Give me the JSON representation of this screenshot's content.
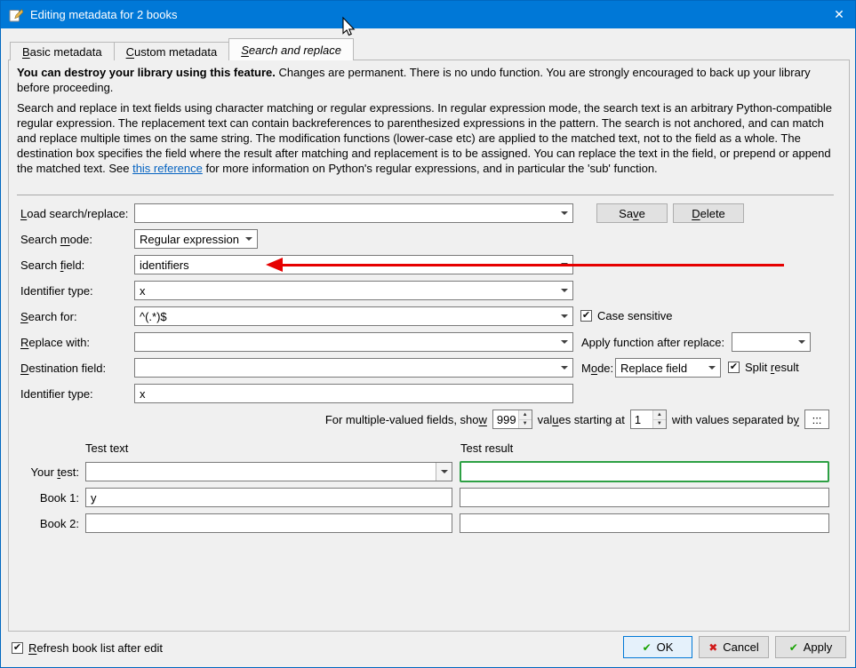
{
  "window": {
    "title": "Editing metadata for 2 books"
  },
  "icons": {
    "close": "✕",
    "check": "✔",
    "ok_icon": "✔",
    "cancel_icon": "✖",
    "apply_icon": "✔",
    "spin_up": "▲",
    "spin_down": "▼"
  },
  "tabs": [
    {
      "label": "&Basic metadata",
      "active": false
    },
    {
      "label": "&Custom metadata",
      "active": false
    },
    {
      "label": "&Search and replace",
      "active": true
    }
  ],
  "intro": {
    "warning_bold": "You can destroy your library using this feature.",
    "warning_rest": " Changes are permanent. There is no undo function. You are strongly encouraged to back up your library before proceeding.",
    "description": "Search and replace in text fields using character matching or regular expressions. In regular expression mode, the search text is an arbitrary Python-compatible regular expression. The replacement text can contain backreferences to parenthesized expressions in the pattern. The search is not anchored, and can match and replace multiple times on the same string. The modification functions (lower-case etc) are applied to the matched text, not to the field as a whole. The destination box specifies the field where the result after matching and replacement is to be assigned. You can replace the text in the field, or prepend or append the matched text. See ",
    "link_text": "this reference",
    "description_tail": " for more information on Python's regular expressions, and in particular the 'sub' function."
  },
  "form": {
    "load_label": "&Load search/replace:",
    "load_value": "",
    "save_button": "Sa&ve",
    "delete_button": "&Delete",
    "search_mode_label": "Search &mode:",
    "search_mode_value": "Regular expression",
    "search_field_label": "Search &field:",
    "search_field_value": "identifiers",
    "identifier_type_label": "Identifier type:",
    "identifier_type_value": "x",
    "search_for_label": "&Search for:",
    "search_for_value": "^(.*)$",
    "case_sensitive_label": "Case sensitive",
    "case_sensitive_checked": true,
    "replace_with_label": "&Replace with:",
    "replace_with_value": "",
    "apply_function_label": "Apply function after replace:",
    "apply_function_value": "",
    "destination_label": "&Destination field:",
    "destination_value": "",
    "mode_label": "M&ode:",
    "mode_value": "Replace field",
    "split_result_label": "Split &result",
    "split_result_checked": true,
    "identifier_type2_label": "Identifier type:",
    "identifier_type2_value": "x",
    "multi_show_label": "For multiple-valued fields, sho&w",
    "multi_show_value": "999",
    "multi_start_label": "val&ues starting at",
    "multi_start_value": "1",
    "multi_sep_label": "with values separated b&y",
    "multi_sep_value": ":::"
  },
  "test": {
    "text_header": "Test text",
    "result_header": "Test result",
    "your_test_label": "Your &test:",
    "your_test_value": "",
    "your_test_result": "",
    "book1_label": "Book 1:",
    "book1_value": "y",
    "book1_result": "",
    "book2_label": "Book 2:",
    "book2_value": "",
    "book2_result": ""
  },
  "footer": {
    "refresh_label": "&Refresh book list after edit",
    "refresh_checked": true,
    "ok_button": "OK",
    "cancel_button": "Cancel",
    "apply_button": "Apply"
  },
  "colors": {
    "titlebar": "#0078d7",
    "link_blue": "#0563c1",
    "annotation_red": "#e60000",
    "valid_green": "#2da044",
    "ok_icon_green": "#18a303",
    "cancel_icon_red": "#d11919"
  }
}
